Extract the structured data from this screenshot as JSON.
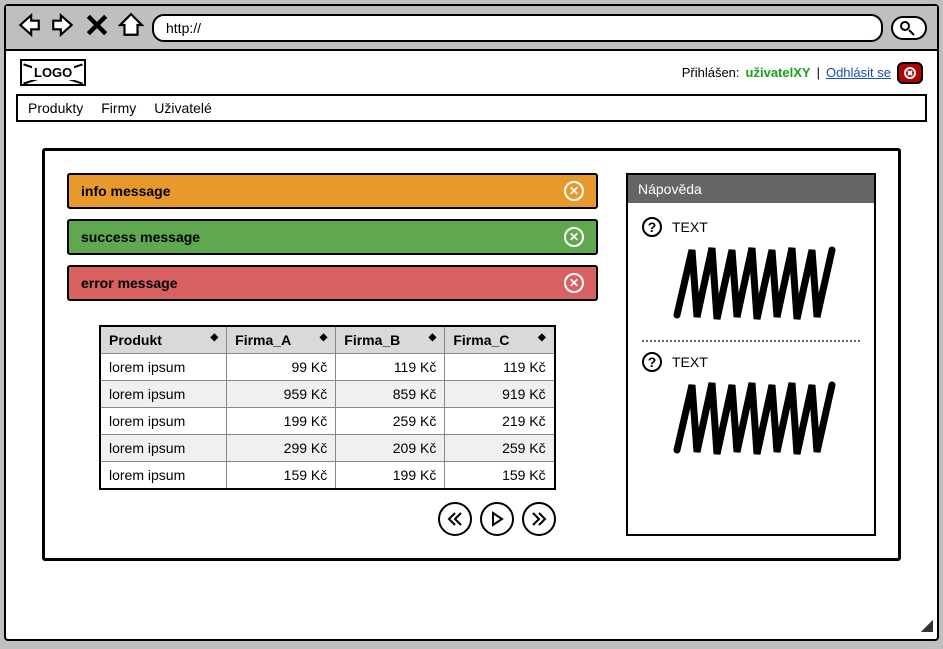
{
  "browser": {
    "url": "http://"
  },
  "header": {
    "logo_text": "LOGO",
    "logged_in_label": "Přihlášen:",
    "user_name": "uživatelXY",
    "logout_label": "Odhlásit se"
  },
  "menu": {
    "items": [
      "Produkty",
      "Firmy",
      "Uživatelé"
    ]
  },
  "messages": {
    "info": "info message",
    "success": "success message",
    "error": "error message"
  },
  "table": {
    "columns": [
      "Produkt",
      "Firma_A",
      "Firma_B",
      "Firma_C"
    ],
    "rows": [
      {
        "product": "lorem ipsum",
        "a": "99 Kč",
        "b": "119 Kč",
        "c": "119 Kč"
      },
      {
        "product": "lorem ipsum",
        "a": "959 Kč",
        "b": "859 Kč",
        "c": "919 Kč"
      },
      {
        "product": "lorem ipsum",
        "a": "199 Kč",
        "b": "259 Kč",
        "c": "219 Kč"
      },
      {
        "product": "lorem ipsum",
        "a": "299 Kč",
        "b": "209 Kč",
        "c": "259 Kč"
      },
      {
        "product": "lorem ipsum",
        "a": "159 Kč",
        "b": "199 Kč",
        "c": "159 Kč"
      }
    ]
  },
  "help": {
    "title": "Nápověda",
    "items": [
      {
        "label": "TEXT"
      },
      {
        "label": "TEXT"
      }
    ]
  }
}
